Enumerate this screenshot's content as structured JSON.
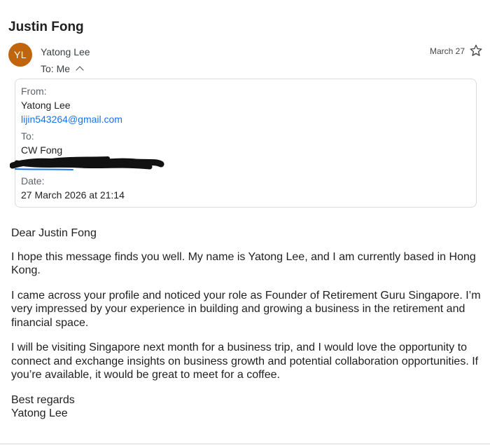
{
  "email": {
    "subject": "Justin Fong",
    "sender": {
      "initials": "YL",
      "name": "Yatong Lee",
      "avatar_color": "#c0640e"
    },
    "to_line": "To: Me",
    "date_short": "March 27",
    "details": {
      "from_label": "From:",
      "from_name": "Yatong Lee",
      "from_email": "lijin543264@gmail.com",
      "to_label": "To:",
      "to_name": "CW Fong",
      "date_label": "Date:",
      "date_value": "27 March 2026 at 21:14"
    },
    "body": {
      "greeting": "Dear Justin Fong",
      "paragraphs": [
        "I hope this message finds you well. My name is Yatong Lee, and I am currently based in Hong Kong.",
        "I came across your profile and noticed your role as Founder of Retirement Guru Singapore. I’m very impressed by your experience in building and growing a business in the retirement and financial space.",
        "I will be visiting Singapore next month for a business trip, and I would love the opportunity to connect and exchange insights on business growth and potential collaboration opportunities. If you’re available, it would be great to meet for a coffee."
      ],
      "signoff": "Best regards",
      "signature": "Yatong Lee"
    }
  },
  "icons": {
    "star": "star-outline-icon",
    "chevron": "chevron-up-icon"
  },
  "colors": {
    "link": "#1a73e8",
    "avatar": "#c0640e",
    "card_border": "#d7dbe0"
  }
}
